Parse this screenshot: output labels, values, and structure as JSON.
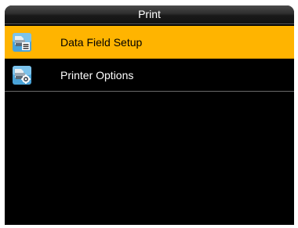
{
  "header": {
    "title": "Print"
  },
  "menu": {
    "items": [
      {
        "label": "Data Field Setup",
        "icon": "data-field-setup-icon",
        "selected": true
      },
      {
        "label": "Printer Options",
        "icon": "printer-options-icon",
        "selected": false
      }
    ]
  },
  "colors": {
    "selection": "#ffb400",
    "background": "#000000",
    "icon_tile": "#4aa3d8"
  }
}
